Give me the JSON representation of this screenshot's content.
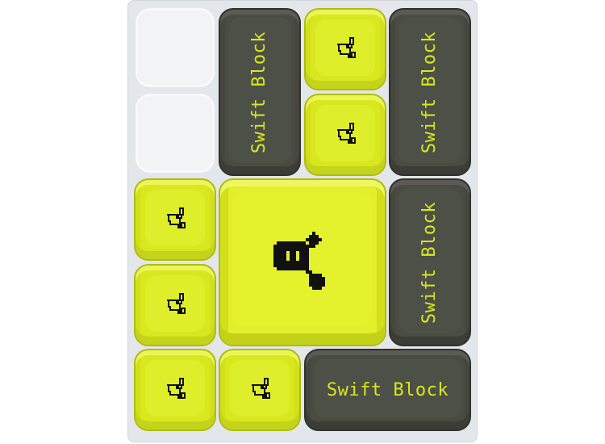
{
  "board": {
    "blocks": [
      {
        "kind": "empty"
      },
      {
        "kind": "empty"
      },
      {
        "kind": "swift",
        "label": "Swift Block",
        "orientation": "vertical"
      },
      {
        "kind": "swift",
        "label": "Swift Block",
        "orientation": "vertical"
      },
      {
        "kind": "swift",
        "label": "Swift Block",
        "orientation": "vertical"
      },
      {
        "kind": "swift",
        "label": "Swift Block",
        "orientation": "horizontal"
      },
      {
        "kind": "small",
        "icon": "bird-icon"
      },
      {
        "kind": "small",
        "icon": "bird-icon"
      },
      {
        "kind": "small",
        "icon": "bird-icon"
      },
      {
        "kind": "small",
        "icon": "bird-icon"
      },
      {
        "kind": "small",
        "icon": "bird-icon"
      },
      {
        "kind": "small",
        "icon": "bird-icon"
      },
      {
        "kind": "player",
        "icon": "bird-face-icon"
      }
    ]
  },
  "colors": {
    "board_bg": "#e3e6ea",
    "yellow_block": "#d9e81e",
    "dark_block": "#4a4c44",
    "dark_block_text": "#d8e71f",
    "icon_ink": "#111111"
  }
}
